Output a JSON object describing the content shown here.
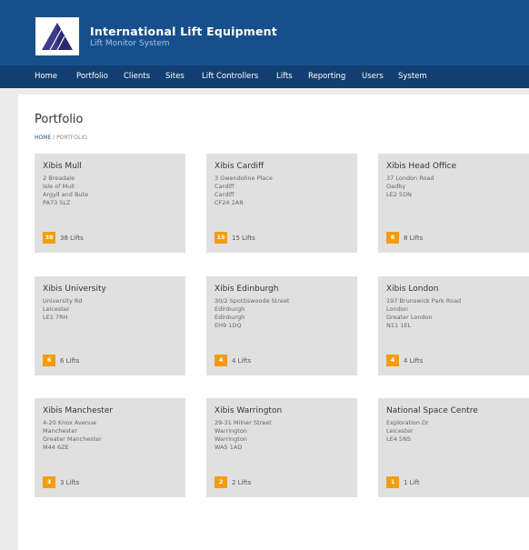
{
  "app": {
    "title": "International Lift Equipment",
    "subtitle": "Lift Monitor System"
  },
  "nav": [
    "Home",
    "Portfolio",
    "Clients",
    "Sites",
    "Lift Controllers",
    "Lifts",
    "Reporting",
    "Users",
    "System"
  ],
  "page": {
    "title": "Portfolio",
    "breadcrumb": [
      "HOME",
      "PORTFOLIO"
    ]
  },
  "sites": [
    {
      "name": "Xibis Mull",
      "address": [
        "2 Breadale",
        "Isle of Mull",
        "Argyll and Bute",
        "PA73 5LZ"
      ],
      "count": "38",
      "lifts": "38 Lifts"
    },
    {
      "name": "Xibis Cardiff",
      "address": [
        "3 Gwendoline Place",
        "Cardiff",
        "Cardiff",
        "CF24 2AR"
      ],
      "count": "15",
      "lifts": "15 Lifts"
    },
    {
      "name": "Xibis Head Office",
      "address": [
        "37 London Road",
        "Oadby",
        "LE2 5DN"
      ],
      "count": "8",
      "lifts": "8 Lifts"
    },
    {
      "name": "Xibis University",
      "address": [
        "University Rd",
        "Leicester",
        "LE1 7RH"
      ],
      "count": "6",
      "lifts": "6 Lifts"
    },
    {
      "name": "Xibis Edinburgh",
      "address": [
        "30/2 Spottiswoode Street",
        "Edinburgh",
        "Edinburgh",
        "EH9 1DQ"
      ],
      "count": "4",
      "lifts": "4 Lifts"
    },
    {
      "name": "Xibis London",
      "address": [
        "197 Brunswick Park Road",
        "London",
        "Greater London",
        "N11 1EL"
      ],
      "count": "4",
      "lifts": "4 Lifts"
    },
    {
      "name": "Xibis Manchester",
      "address": [
        "4-20 Knox Avenue",
        "Manchester",
        "Greater Manchester",
        "M44 6ZE"
      ],
      "count": "3",
      "lifts": "3 Lifts"
    },
    {
      "name": "Xibis Warrington",
      "address": [
        "29-31 Milner Street",
        "Warrington",
        "Warrington",
        "WA5 1AD"
      ],
      "count": "2",
      "lifts": "2 Lifts"
    },
    {
      "name": "National Space Centre",
      "address": [
        "Exploration Dr",
        "Leicester",
        "LE4 5NS"
      ],
      "count": "1",
      "lifts": "1 Lift"
    }
  ],
  "colors": {
    "header": "#174f8c",
    "nav": "#123f71",
    "badge": "#f39c12",
    "card": "#e0e0e0"
  }
}
